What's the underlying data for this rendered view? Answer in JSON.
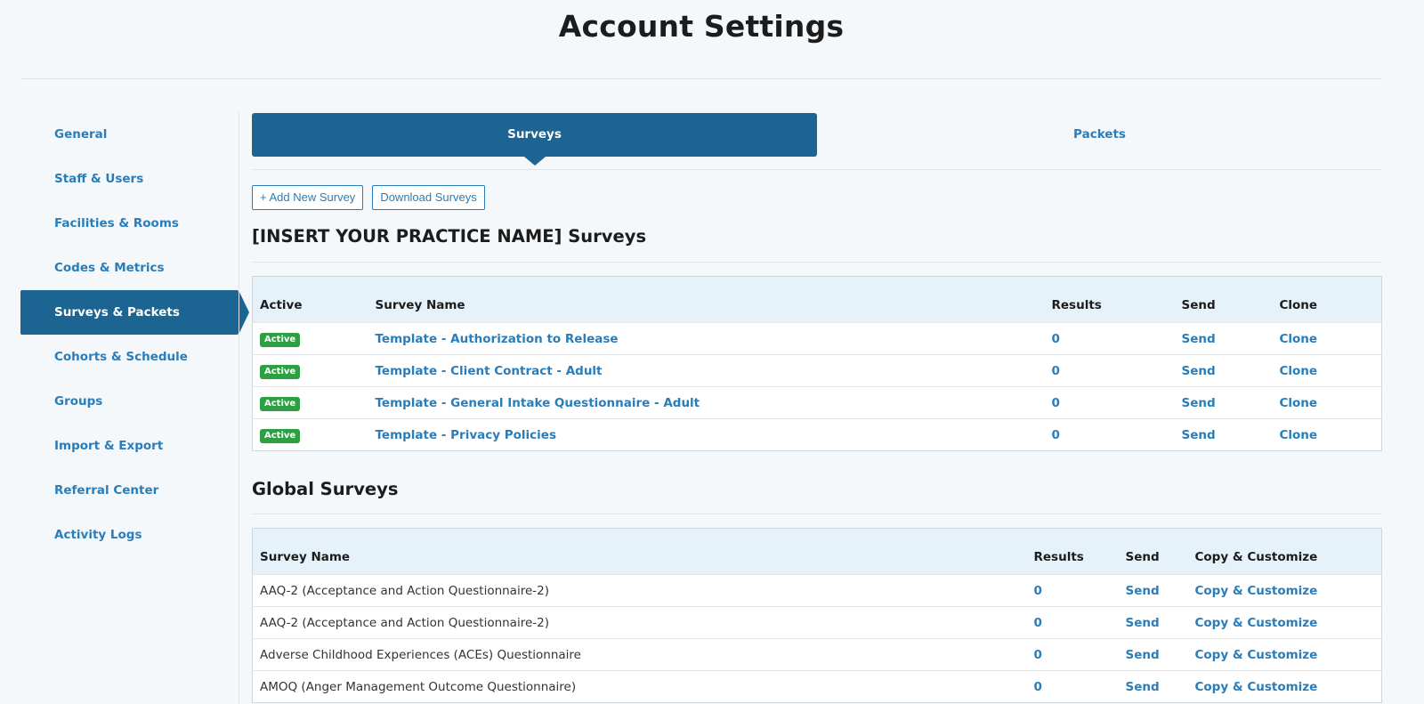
{
  "page": {
    "title": "Account Settings"
  },
  "sidebar": {
    "items": [
      {
        "label": "General"
      },
      {
        "label": "Staff & Users"
      },
      {
        "label": "Facilities & Rooms"
      },
      {
        "label": "Codes & Metrics"
      },
      {
        "label": "Surveys & Packets",
        "active": true
      },
      {
        "label": "Cohorts & Schedule"
      },
      {
        "label": "Groups"
      },
      {
        "label": "Import & Export"
      },
      {
        "label": "Referral Center"
      },
      {
        "label": "Activity Logs"
      }
    ]
  },
  "tabs": [
    {
      "label": "Surveys",
      "active": true
    },
    {
      "label": "Packets"
    }
  ],
  "buttons": {
    "add_survey": "+ Add New Survey",
    "download_surveys": "Download Surveys"
  },
  "practice_section": {
    "title": "[INSERT YOUR PRACTICE NAME] Surveys",
    "headers": {
      "active": "Active",
      "name": "Survey Name",
      "results": "Results",
      "send": "Send",
      "clone": "Clone"
    },
    "rows": [
      {
        "status": "Active",
        "name": "Template - Authorization to Release",
        "results": "0",
        "send": "Send",
        "clone": "Clone"
      },
      {
        "status": "Active",
        "name": "Template - Client Contract - Adult",
        "results": "0",
        "send": "Send",
        "clone": "Clone"
      },
      {
        "status": "Active",
        "name": "Template - General Intake Questionnaire - Adult",
        "results": "0",
        "send": "Send",
        "clone": "Clone"
      },
      {
        "status": "Active",
        "name": "Template - Privacy Policies",
        "results": "0",
        "send": "Send",
        "clone": "Clone"
      }
    ]
  },
  "global_section": {
    "title": "Global Surveys",
    "headers": {
      "name": "Survey Name",
      "results": "Results",
      "send": "Send",
      "copy": "Copy & Customize"
    },
    "rows": [
      {
        "name": "AAQ-2 (Acceptance and Action Questionnaire-2)",
        "results": "0",
        "send": "Send",
        "copy": "Copy & Customize"
      },
      {
        "name": "AAQ-2 (Acceptance and Action Questionnaire-2)",
        "results": "0",
        "send": "Send",
        "copy": "Copy & Customize"
      },
      {
        "name": "Adverse Childhood Experiences (ACEs) Questionnaire",
        "results": "0",
        "send": "Send",
        "copy": "Copy & Customize"
      },
      {
        "name": "AMOQ (Anger Management Outcome Questionnaire)",
        "results": "0",
        "send": "Send",
        "copy": "Copy & Customize"
      }
    ]
  },
  "colors": {
    "primary": "#1c6491",
    "link": "#2a7db8",
    "badge": "#2ea044",
    "header_bg": "#e6f2fa"
  }
}
